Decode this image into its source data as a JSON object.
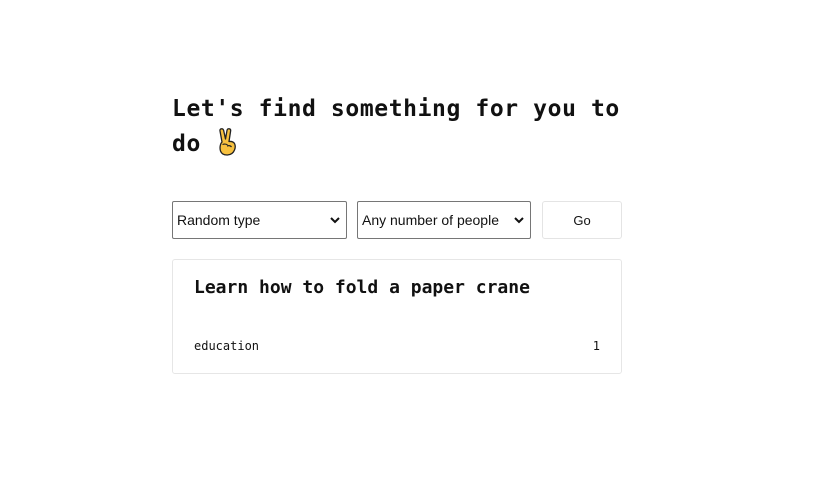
{
  "header": {
    "title": "Let's find something for you to do",
    "emoji_icon": "victory-hand-icon"
  },
  "filters": {
    "type_select": {
      "selected": "Random type"
    },
    "participants_select": {
      "selected": "Any number of people"
    },
    "go_label": "Go"
  },
  "activity": {
    "title": "Learn how to fold a paper crane",
    "type": "education",
    "participants": "1"
  },
  "colors": {
    "text": "#111111",
    "select_border": "#767676",
    "card_border": "#e6e6e6",
    "emoji": "#f7c13f"
  }
}
